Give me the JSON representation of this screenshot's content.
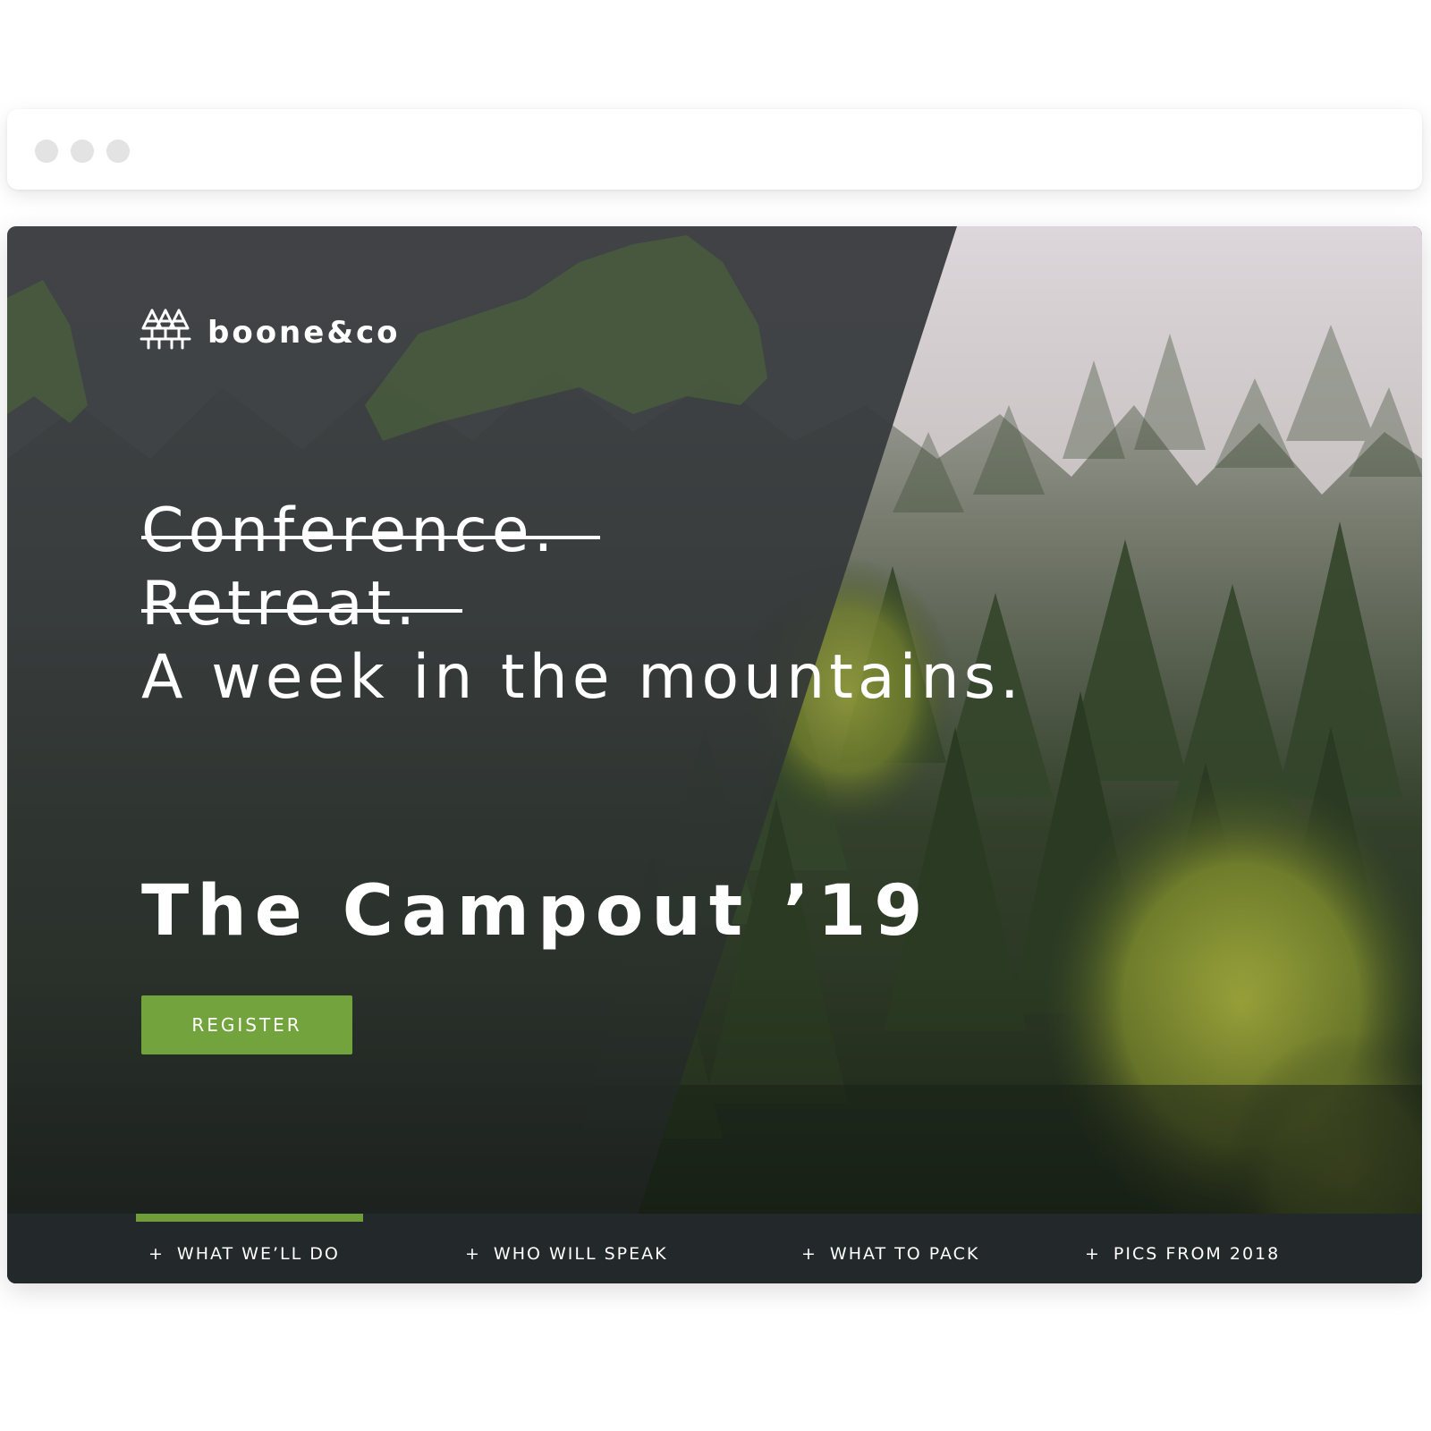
{
  "browser": {
    "dots": [
      "window-dot",
      "window-dot",
      "window-dot"
    ]
  },
  "brand": {
    "name": "boone&co",
    "icon": "pine-trees-icon"
  },
  "hero": {
    "struck_lines": [
      "Conference.",
      "Retreat."
    ],
    "tagline": "A week in the mountains.",
    "title": "The Campout ’19"
  },
  "cta": {
    "register_label": "REGISTER"
  },
  "nav": {
    "active_index": 0,
    "items": [
      {
        "prefix": "+",
        "label": "WHAT WE’LL DO"
      },
      {
        "prefix": "+",
        "label": "WHO WILL SPEAK"
      },
      {
        "prefix": "+",
        "label": "WHAT TO PACK"
      },
      {
        "prefix": "+",
        "label": "PICS FROM 2018"
      }
    ]
  },
  "colors": {
    "accent_green": "#73a33c",
    "overlay_dark": "#3b3d40",
    "fog": "#d9d3d6",
    "nav_background": "#23282a"
  }
}
